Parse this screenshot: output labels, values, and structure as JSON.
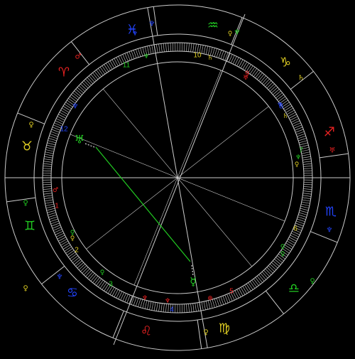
{
  "chart": {
    "type": "astrological-natal-wheel",
    "zodiac_signs": [
      {
        "glyph": "♓",
        "name": "pisces-icon",
        "color": "#2244ff"
      },
      {
        "glyph": "♒",
        "name": "aquarius-icon",
        "color": "#22cc22"
      },
      {
        "glyph": "♑",
        "name": "capricorn-icon",
        "color": "#ddcc22"
      },
      {
        "glyph": "♐",
        "name": "sagittarius-icon",
        "color": "#ee2222"
      },
      {
        "glyph": "♏",
        "name": "scorpio-icon",
        "color": "#2244ff"
      },
      {
        "glyph": "♎",
        "name": "libra-icon",
        "color": "#22cc22"
      },
      {
        "glyph": "♍",
        "name": "virgo-icon",
        "color": "#ddcc22"
      },
      {
        "glyph": "♌",
        "name": "leo-icon",
        "color": "#ee2222"
      },
      {
        "glyph": "♋",
        "name": "cancer-icon",
        "color": "#2244ff"
      },
      {
        "glyph": "♊",
        "name": "gemini-icon",
        "color": "#22cc22"
      },
      {
        "glyph": "♉",
        "name": "taurus-icon",
        "color": "#ddcc22"
      },
      {
        "glyph": "♈",
        "name": "aries-icon",
        "color": "#ee2222"
      }
    ],
    "house_numbers": [
      {
        "label": "10",
        "color": "#ddcc22"
      },
      {
        "label": "9",
        "color": "#ee2222"
      },
      {
        "label": "8",
        "color": "#2244ff"
      },
      {
        "label": "7",
        "color": "#22cc22"
      },
      {
        "label": "6",
        "color": "#ddcc22"
      },
      {
        "label": "5",
        "color": "#ee2222"
      },
      {
        "label": "4",
        "color": "#2244ff"
      },
      {
        "label": "3",
        "color": "#22cc22"
      },
      {
        "label": "2",
        "color": "#ddcc22"
      },
      {
        "label": "1",
        "color": "#ee2222"
      },
      {
        "label": "12",
        "color": "#2244ff"
      },
      {
        "label": "11",
        "color": "#22cc22"
      }
    ],
    "outer_markers": [
      {
        "glyph": "♆",
        "color": "#2244ff"
      },
      {
        "glyph": "♆",
        "color": "#22cc22"
      },
      {
        "glyph": "♄",
        "color": "#ddcc22"
      },
      {
        "glyph": "♅",
        "color": "#ee2222"
      },
      {
        "glyph": "♆",
        "color": "#2244ff"
      },
      {
        "glyph": "♀",
        "color": "#22cc22"
      },
      {
        "glyph": "♀",
        "color": "#ddcc22"
      },
      {
        "glyph": "♆",
        "color": "#2244ff"
      },
      {
        "glyph": "♆",
        "color": "#2244ff"
      },
      {
        "glyph": "♀",
        "color": "#ddcc22"
      },
      {
        "glyph": "♀",
        "color": "#22cc22"
      },
      {
        "glyph": "♀",
        "color": "#ddcc22"
      },
      {
        "glyph": "♂",
        "color": "#ee2222"
      }
    ],
    "inner_markers": [
      {
        "glyph": "♆",
        "color": "#22cc22"
      },
      {
        "glyph": "♄",
        "color": "#ddcc22"
      },
      {
        "glyph": "♅",
        "color": "#ee2222"
      },
      {
        "glyph": "♆",
        "color": "#2244ff"
      },
      {
        "glyph": "♄",
        "color": "#ddcc22"
      },
      {
        "glyph": "♀",
        "color": "#ddcc22"
      },
      {
        "glyph": "♆",
        "color": "#22cc22"
      },
      {
        "glyph": "♀",
        "color": "#22cc22"
      },
      {
        "glyph": "♀",
        "color": "#22cc22"
      },
      {
        "glyph": "⊕",
        "color": "#ee2222"
      },
      {
        "glyph": "♆",
        "color": "#ee2222"
      },
      {
        "glyph": "♆",
        "color": "#ee2222"
      },
      {
        "glyph": "♀",
        "color": "#ddcc22"
      },
      {
        "glyph": "♀",
        "color": "#22cc22"
      },
      {
        "glyph": "♂",
        "color": "#ee2222"
      },
      {
        "glyph": "♀",
        "color": "#22cc22"
      },
      {
        "glyph": "♆",
        "color": "#2244ff"
      },
      {
        "glyph": "♀",
        "color": "#ddcc22"
      }
    ],
    "aspect_planets": [
      {
        "glyph": "♅",
        "color": "#22cc22",
        "name": "uranus-aspect-glyph"
      },
      {
        "glyph": "☿",
        "color": "#22cc22",
        "name": "mercury-aspect-glyph"
      }
    ],
    "colors": {
      "background": "#000000",
      "wheel_lines": "#cccccc",
      "aspect_line": "#22cc22",
      "fire": "#ee2222",
      "earth": "#ddcc22",
      "air": "#22cc22",
      "water": "#2244ff"
    }
  }
}
